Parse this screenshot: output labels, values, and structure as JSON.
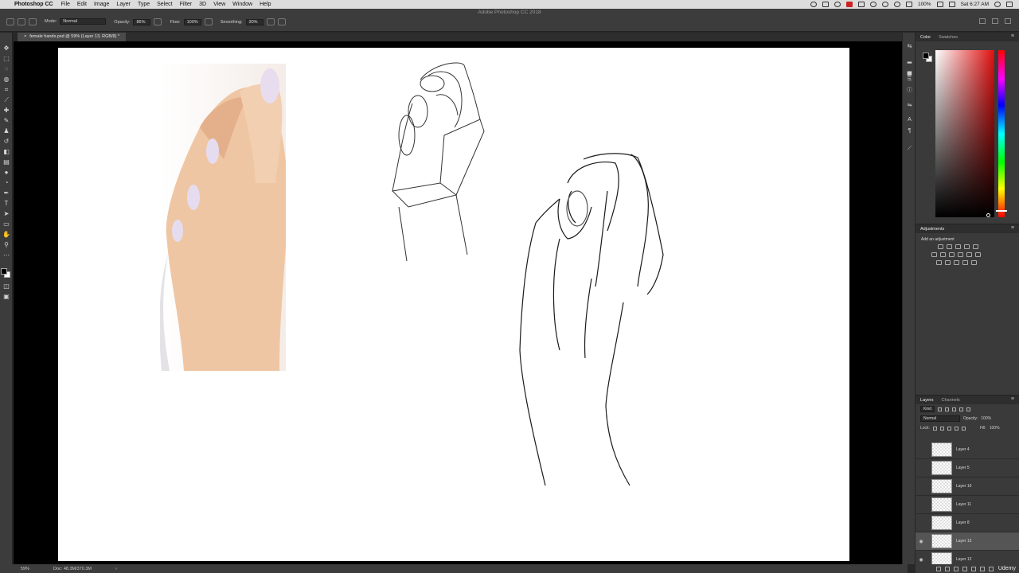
{
  "menubar": {
    "app_name": "Photoshop CC",
    "items": [
      "File",
      "Edit",
      "Image",
      "Layer",
      "Type",
      "Select",
      "Filter",
      "3D",
      "View",
      "Window",
      "Help"
    ],
    "battery": "100%",
    "clock": "Sat 6:27 AM"
  },
  "window_title": "Adobe Photoshop CC 2018",
  "options_bar": {
    "mode_label": "Mode:",
    "mode_value": "Normal",
    "opacity_label": "Opacity:",
    "opacity_value": "86%",
    "flow_label": "Flow:",
    "flow_value": "100%",
    "smoothing_label": "Smoothing:",
    "smoothing_value": "30%"
  },
  "document_tab": {
    "title": "female hands.psd @ 59% (Layer 13, RGB/8) *"
  },
  "status_bar": {
    "zoom": "59%",
    "doc_size": "Doc: 48.3M/370.3M"
  },
  "color_panel": {
    "tabs": [
      "Color",
      "Swatches"
    ],
    "accent": "#e01010"
  },
  "adjustments_panel": {
    "title": "Adjustments",
    "subtitle": "Add an adjustment"
  },
  "layers_panel": {
    "tabs": [
      "Layers",
      "Channels"
    ],
    "filter_value": "Kind",
    "blend_value": "Normal",
    "opacity_label": "Opacity:",
    "opacity_value": "100%",
    "lock_label": "Lock:",
    "fill_label": "Fill:",
    "fill_value": "100%",
    "layers": [
      {
        "name": "Layer 4",
        "visible": false,
        "active": false
      },
      {
        "name": "Layer 5",
        "visible": false,
        "active": false
      },
      {
        "name": "Layer 10",
        "visible": false,
        "active": false
      },
      {
        "name": "Layer 11",
        "visible": false,
        "active": false
      },
      {
        "name": "Layer 8",
        "visible": false,
        "active": false
      },
      {
        "name": "Layer 13",
        "visible": true,
        "active": true
      },
      {
        "name": "Layer 12",
        "visible": true,
        "active": false
      }
    ]
  },
  "brand": "Udemy"
}
